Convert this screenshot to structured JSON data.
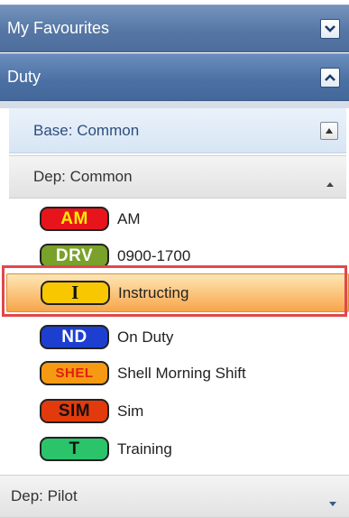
{
  "panel": {
    "favourites": {
      "label": "My Favourites",
      "toggle_icon": "chevron-down"
    },
    "duty": {
      "label": "Duty",
      "toggle_icon": "chevron-up"
    },
    "base": {
      "label": "Base: Common",
      "toggle_icon": "collapse-up"
    },
    "dep_common": {
      "label": "Dep: Common",
      "arrow_icon": "triangle-up"
    },
    "items": [
      {
        "code": "AM",
        "label": "AM",
        "color": "#e8141b",
        "selected": false
      },
      {
        "code": "DRV",
        "label": "0900-1700",
        "color": "#7aa12a",
        "selected": false
      },
      {
        "code": "I",
        "label": "Instructing",
        "color": "#f9c700",
        "selected": true
      },
      {
        "code": "ND",
        "label": "On Duty",
        "color": "#1d3fd0",
        "selected": false
      },
      {
        "code": "SHEL",
        "label": "Shell Morning Shift",
        "color": "#f59a12",
        "selected": false
      },
      {
        "code": "SIM",
        "label": "Sim",
        "color": "#e23a0c",
        "selected": false
      },
      {
        "code": "T",
        "label": "Training",
        "color": "#2cc46a",
        "selected": false
      }
    ],
    "dep_pilot": {
      "label": "Dep: Pilot",
      "arrow_icon": "triangle-down"
    }
  },
  "colors": {
    "header_blue": "#5677a5",
    "selection_outline": "#e0484b",
    "selection_fill": "#fbc37a"
  }
}
